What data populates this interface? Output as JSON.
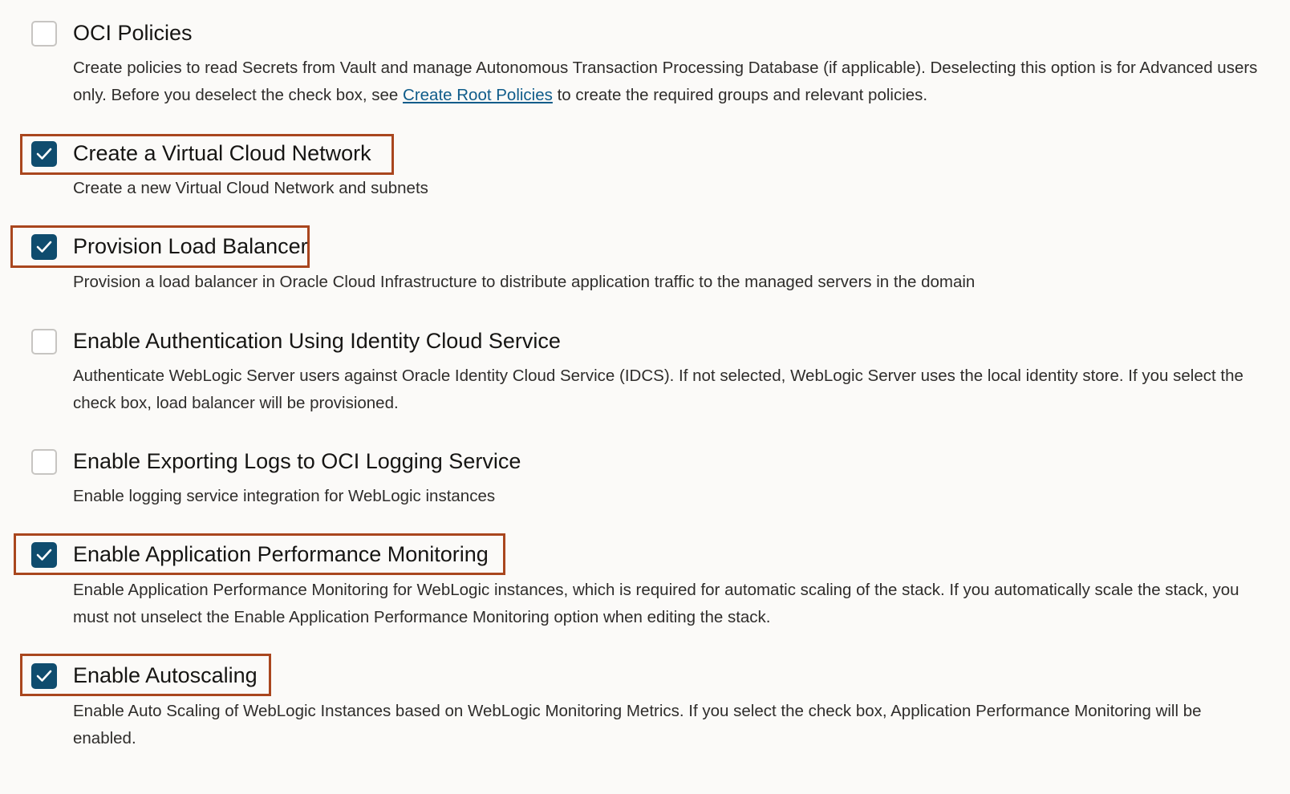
{
  "options": [
    {
      "id": "oci-policies",
      "title": "OCI Policies",
      "checked": false,
      "description_before": "Create policies to read Secrets from Vault and manage Autonomous Transaction Processing Database (if applicable). Deselecting this option is for Advanced users only. Before you deselect the check box, see ",
      "description_link": "Create Root Policies",
      "description_after": " to create the required groups and relevant policies."
    },
    {
      "id": "create-vcn",
      "title": "Create a Virtual Cloud Network",
      "checked": true,
      "highlighted": true,
      "description": "Create a new Virtual Cloud Network and subnets"
    },
    {
      "id": "provision-load-balancer",
      "title": "Provision Load Balancer",
      "checked": true,
      "highlighted": true,
      "description": "Provision a load balancer in Oracle Cloud Infrastructure to distribute application traffic to the managed servers in the domain"
    },
    {
      "id": "enable-idcs",
      "title": "Enable Authentication Using Identity Cloud Service",
      "checked": false,
      "description": "Authenticate WebLogic Server users against Oracle Identity Cloud Service (IDCS). If not selected, WebLogic Server uses the local identity store. If you select the check box, load balancer will be provisioned."
    },
    {
      "id": "enable-logging",
      "title": "Enable Exporting Logs to OCI Logging Service",
      "checked": false,
      "description": "Enable logging service integration for WebLogic instances"
    },
    {
      "id": "enable-apm",
      "title": "Enable Application Performance Monitoring",
      "checked": true,
      "highlighted": true,
      "description": "Enable Application Performance Monitoring for WebLogic instances, which is required for automatic scaling of the stack. If you automatically scale the stack, you must not unselect the Enable Application Performance Monitoring option when editing the stack."
    },
    {
      "id": "enable-autoscaling",
      "title": "Enable Autoscaling",
      "checked": true,
      "highlighted": true,
      "description": "Enable Auto Scaling of WebLogic Instances based on WebLogic Monitoring Metrics. If you select the check box, Application Performance Monitoring will be enabled."
    }
  ],
  "colors": {
    "checkbox_checked": "#0f4c6e",
    "highlight_border": "#a9461e",
    "link": "#0f5c8a"
  }
}
